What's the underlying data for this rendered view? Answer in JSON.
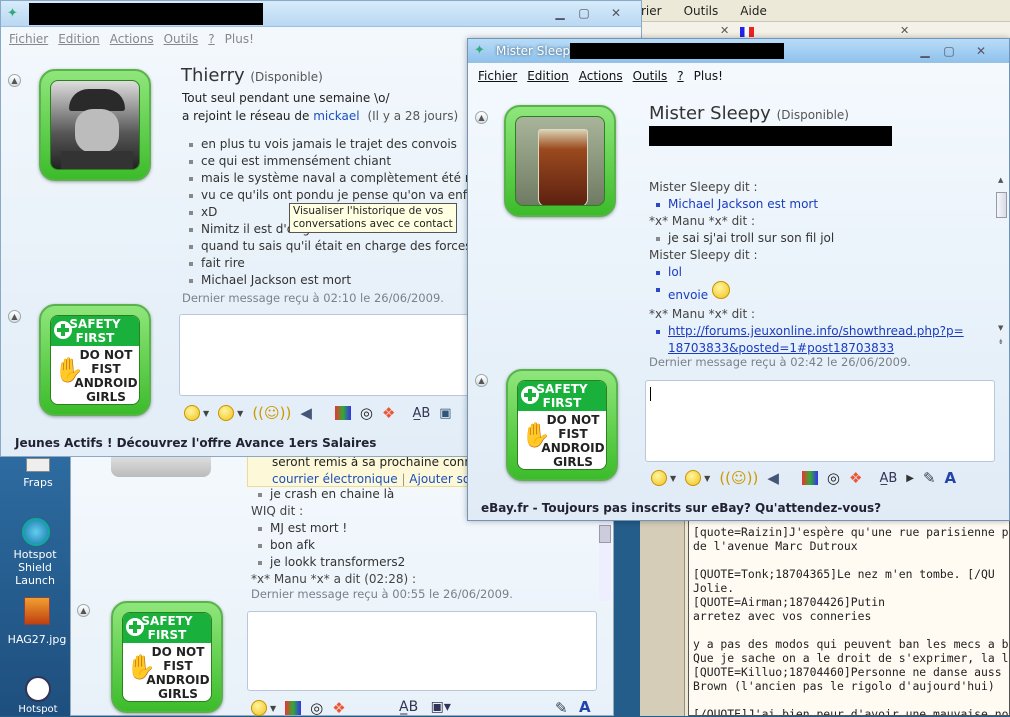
{
  "desktop": {
    "menus": [
      "rier",
      "Outils",
      "Aide"
    ],
    "icons": [
      {
        "label": "Fraps"
      },
      {
        "label": "Hotspot Shield Launch"
      },
      {
        "label": "HAG27.jpg"
      },
      {
        "label": "Hotspot"
      }
    ],
    "forum_text": [
      "[quote=Raizin]J'espère qu'une rue parisienne port",
      "de l'avenue Marc Dutroux",
      "",
      "[QUOTE=Tonk;18704365]Le nez m'en tombe. [/QU",
      "Jolie.",
      "[QUOTE=Airman;18704426]Putin",
      "arretez avec vos conneries",
      "",
      "y a pas des modos qui peuvent ban les mecs a bla",
      "Que je sache on a le droit de s'exprimer, la liberté",
      "[QUOTE=Killuo;18704460]Personne ne danse auss",
      "Brown (l'ancien pas le rigolo d'aujourd'hui)",
      "",
      "[/QUOTE]J'ai bien peur d'avoir une mauvaise nouv"
    ]
  },
  "win1": {
    "menu": [
      "Fichier",
      "Edition",
      "Actions",
      "Outils",
      "?",
      "Plus!"
    ],
    "contact_name": "Thierry",
    "status": "(Disponible)",
    "personal_message": "Tout seul pendant une semaine \\o/",
    "network_prefix": "a rejoint le réseau de",
    "network_user": "mickael",
    "network_time": "(Il y a 28 jours)",
    "messages": [
      "en plus tu vois jamais le trajet des convois",
      "ce qui est immensément chiant",
      "mais le système naval a complètement été rev",
      "vu ce qu'ils ont pondu je pense qu'on va enfin",
      "xD",
      "Nimitz il est d'origine allemande",
      "quand tu sais qu'il était en charge des forces",
      "fait rire",
      "Michael Jackson est mort"
    ],
    "last_message": "Dernier message reçu à 02:10 le 26/06/2009.",
    "tooltip": [
      "Visualiser l'historique de vos",
      "conversations avec ce contact"
    ],
    "ad": "Jeunes Actifs ! Découvrez l'offre Avance 1ers Salaires"
  },
  "win3": {
    "notice": [
      "seront remis à sa prochaine connexio"
    ],
    "links": [
      "courrier électronique",
      "Ajouter son n°"
    ],
    "lines": [
      {
        "type": "bullet",
        "text": "je crash en chaine là"
      },
      {
        "type": "speaker",
        "text": "WIQ dit :"
      },
      {
        "type": "bullet",
        "text": "MJ est mort !"
      },
      {
        "type": "bullet",
        "text": "bon afk"
      },
      {
        "type": "bullet",
        "text": "je lookk transformers2"
      },
      {
        "type": "speaker",
        "text": "*x* Manu *x* a dit (02:28) :"
      }
    ],
    "last_message": "Dernier message reçu à 00:55 le 26/06/2009."
  },
  "win2": {
    "title": "Mister Sleepy",
    "menu": [
      "Fichier",
      "Edition",
      "Actions",
      "Outils",
      "?",
      "Plus!"
    ],
    "contact_name": "Mister Sleepy",
    "status": "(Disponible)",
    "conversation": [
      {
        "type": "speaker",
        "text": "Mister Sleepy dit :"
      },
      {
        "type": "bullet",
        "text": "Michael Jackson est mort",
        "blue": true
      },
      {
        "type": "speaker",
        "text": "*x* Manu *x* dit :"
      },
      {
        "type": "bullet",
        "text": "je sai sj'ai troll sur son fil jol",
        "blue": false
      },
      {
        "type": "speaker",
        "text": "Mister Sleepy dit :"
      },
      {
        "type": "bullet",
        "text": "lol",
        "blue": true
      },
      {
        "type": "bullet",
        "text": "envoie",
        "blue": true,
        "emoticon": true
      },
      {
        "type": "speaker",
        "text": "*x* Manu *x* dit :"
      },
      {
        "type": "link",
        "text": "http://forums.jeuxonline.info/showthread.php?p=",
        "text2": "18703833&posted=1#post18703833"
      }
    ],
    "last_message": "Dernier message reçu à 02:42 le 26/06/2009.",
    "ad": "eBay.fr - Toujours pas inscrits sur eBay? Qu'attendez-vous?"
  },
  "sign": {
    "line1": "SAFETY",
    "line2": "FIRST",
    "body": [
      "DO NOT",
      "FIST",
      "ANDROID",
      "GIRLS"
    ]
  },
  "colors": {
    "accent_green": "#3cbc2a",
    "link_blue": "#1a3cc0",
    "titlebar": "#c8e1f5"
  }
}
